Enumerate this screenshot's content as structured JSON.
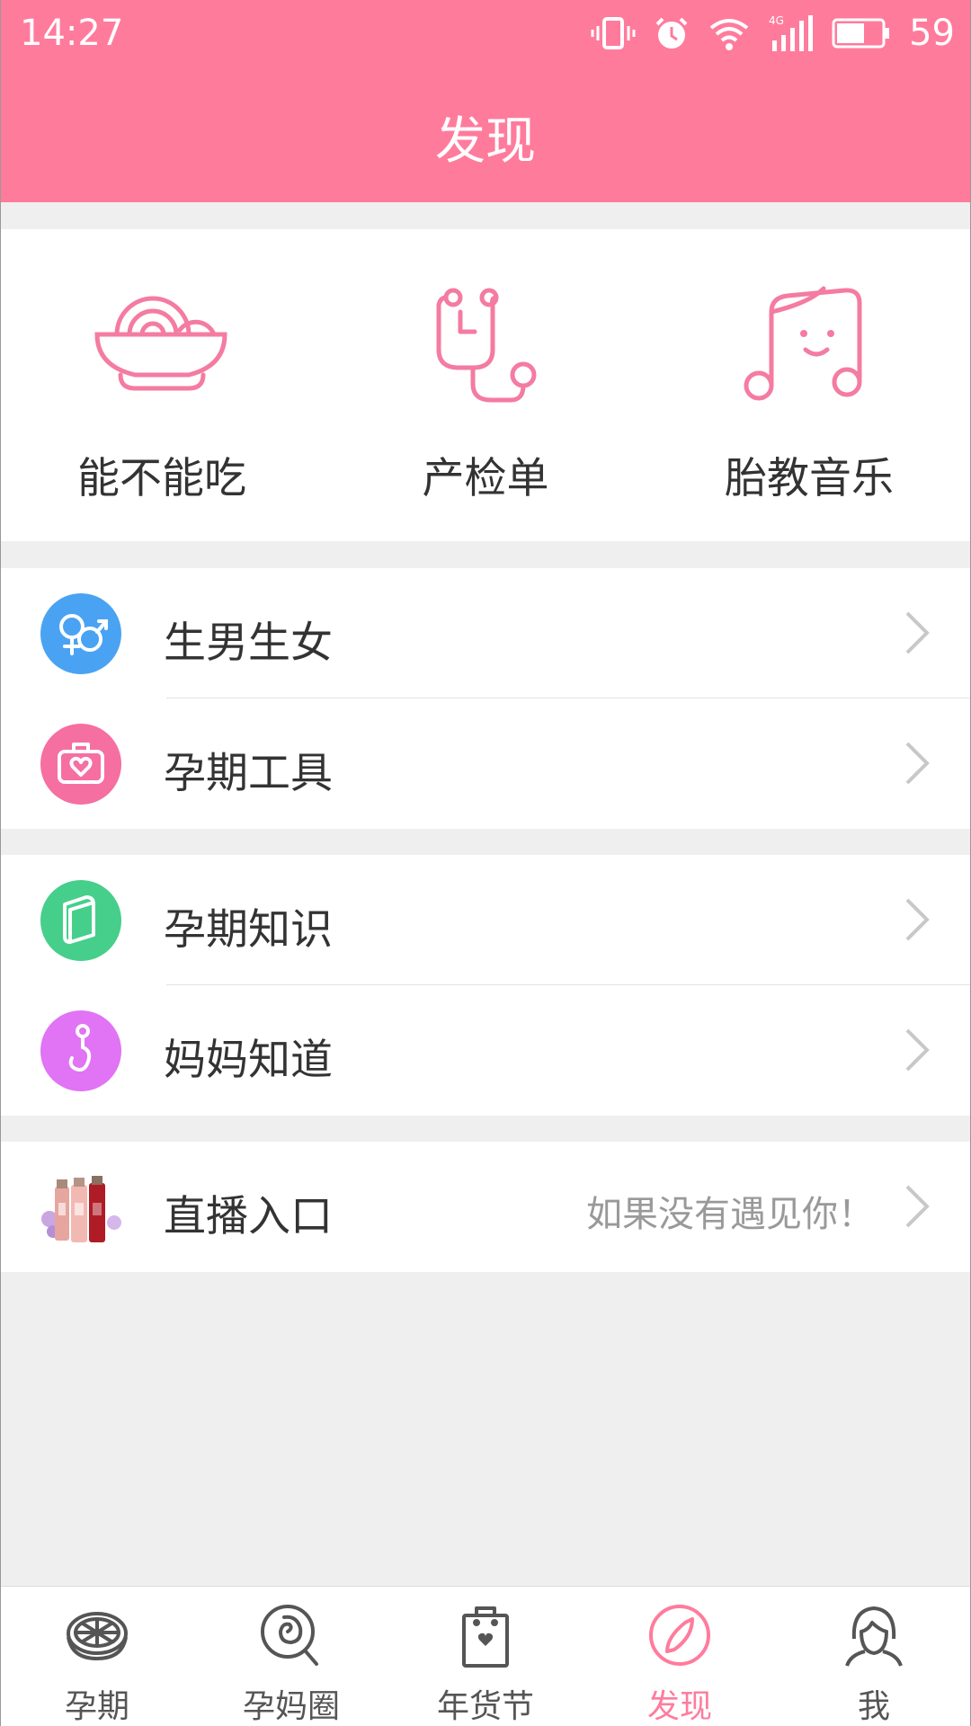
{
  "status_bar": {
    "time": "14:27",
    "battery_level": "59",
    "icons": [
      "vibrate-icon",
      "alarm-icon",
      "wifi-icon",
      "signal-4g-icon",
      "battery-icon"
    ]
  },
  "header": {
    "title": "发现",
    "background_color": "#ff7b9c"
  },
  "grid": {
    "items": [
      {
        "label": "能不能吃",
        "icon": "noodle-bowl-icon"
      },
      {
        "label": "产检单",
        "icon": "stethoscope-icon"
      },
      {
        "label": "胎教音乐",
        "icon": "music-note-icon"
      }
    ]
  },
  "list": {
    "gender": {
      "label": "生男生女",
      "icon": "gender-icon",
      "color": "#4aa3f2"
    },
    "tools": {
      "label": "孕期工具",
      "icon": "toolkit-icon",
      "color": "#f56fa1"
    },
    "knowledge": {
      "label": "孕期知识",
      "icon": "book-icon",
      "color": "#45cf8a"
    },
    "mom_know": {
      "label": "妈妈知道",
      "icon": "question-icon",
      "color": "#e173f5"
    },
    "live": {
      "label": "直播入口",
      "icon": "cosmetics-thumbnail",
      "value": "如果没有遇见你！"
    }
  },
  "bottom_nav": {
    "items": [
      {
        "label": "孕期",
        "icon": "fruit-slice-icon",
        "active": false
      },
      {
        "label": "孕妈圈",
        "icon": "lollipop-icon",
        "active": false
      },
      {
        "label": "年货节",
        "icon": "shopping-bag-icon",
        "active": false
      },
      {
        "label": "发现",
        "icon": "compass-icon",
        "active": true
      },
      {
        "label": "我",
        "icon": "profile-icon",
        "active": false
      }
    ],
    "active_color": "#ff7b9c"
  }
}
